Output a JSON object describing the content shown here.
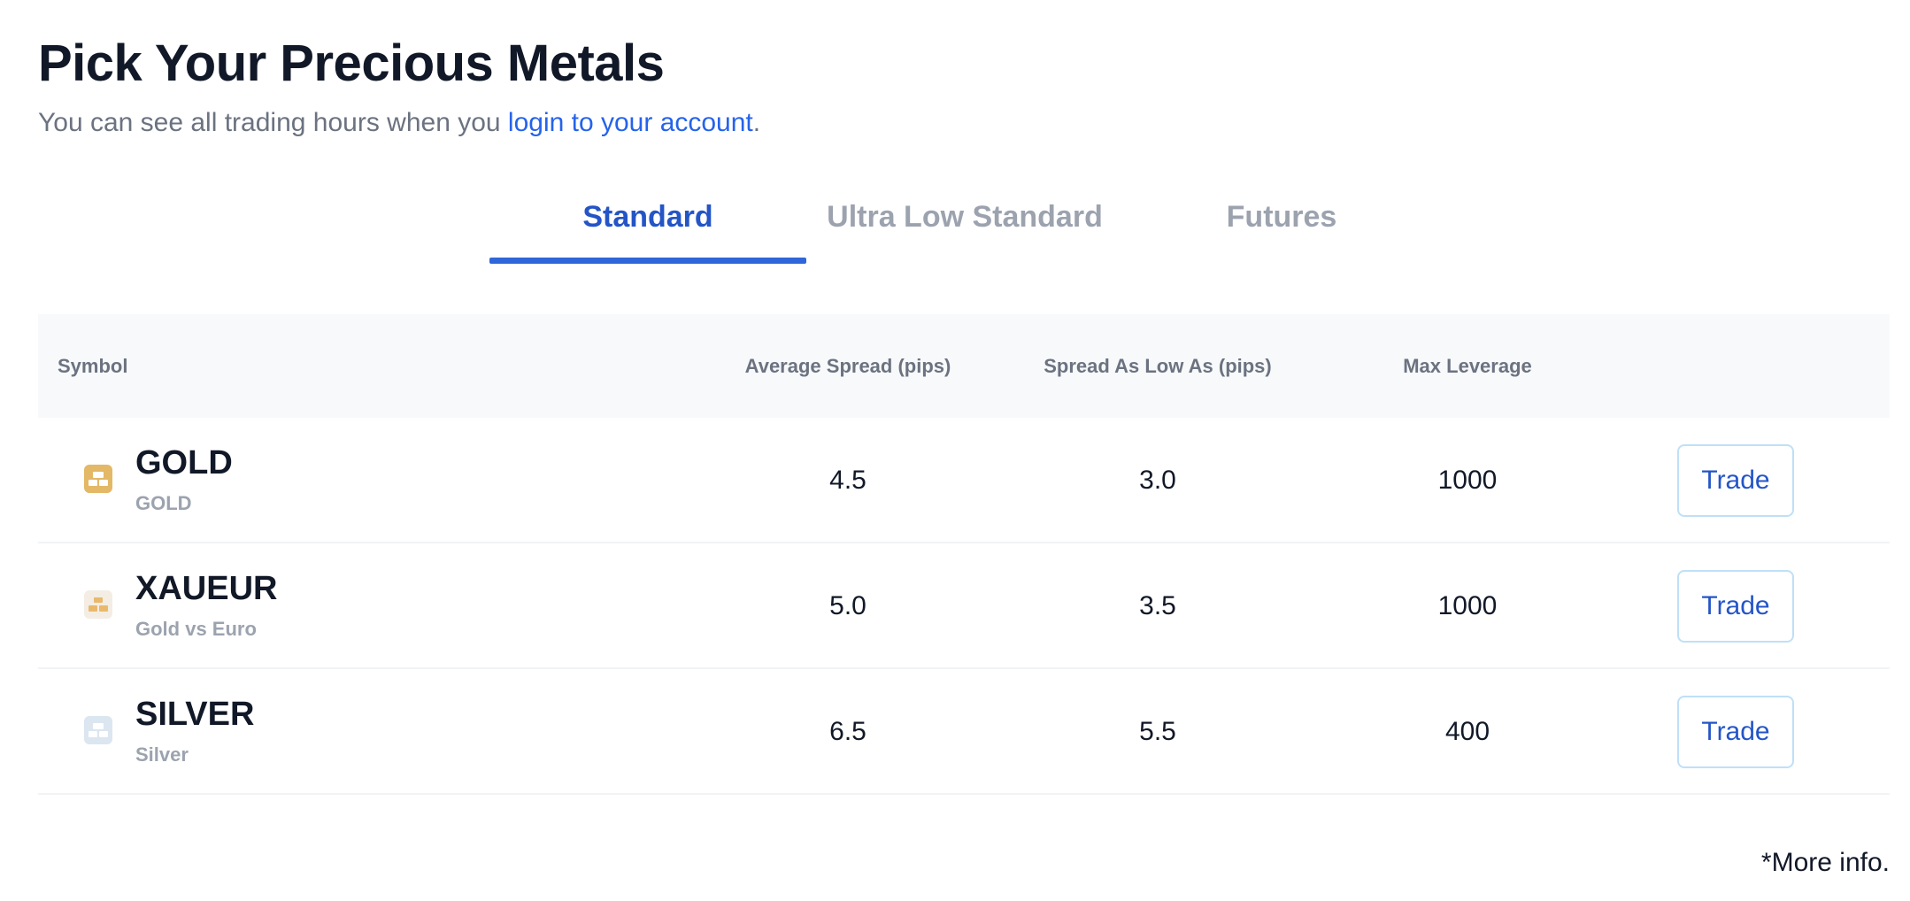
{
  "header": {
    "title": "Pick Your Precious Metals",
    "subtitle_prefix": "You can see all trading hours when you ",
    "subtitle_link": "login to your account",
    "subtitle_suffix": "."
  },
  "tabs": [
    {
      "label": "Standard",
      "active": true
    },
    {
      "label": "Ultra Low Standard",
      "active": false
    },
    {
      "label": "Futures",
      "active": false
    }
  ],
  "table": {
    "columns": {
      "symbol": "Symbol",
      "avg_spread": "Average Spread (pips)",
      "low_spread": "Spread As Low As (pips)",
      "max_leverage": "Max Leverage"
    },
    "rows": [
      {
        "symbol": "GOLD",
        "description": "GOLD",
        "avg_spread": "4.5",
        "low_spread": "3.0",
        "max_leverage": "1000",
        "action": "Trade",
        "icon": "gold-bars-icon"
      },
      {
        "symbol": "XAUEUR",
        "description": "Gold vs Euro",
        "avg_spread": "5.0",
        "low_spread": "3.5",
        "max_leverage": "1000",
        "action": "Trade",
        "icon": "gold-euro-bars-icon"
      },
      {
        "symbol": "SILVER",
        "description": "Silver",
        "avg_spread": "6.5",
        "low_spread": "5.5",
        "max_leverage": "400",
        "action": "Trade",
        "icon": "silver-bars-icon"
      }
    ]
  },
  "footer": {
    "more_info": "*More info."
  },
  "colors": {
    "accent": "#2455c7",
    "link": "#2563eb",
    "tab_indicator": "#2f66d9",
    "gold_icon": "#e3b866",
    "silver_icon": "#dbe6f0"
  }
}
